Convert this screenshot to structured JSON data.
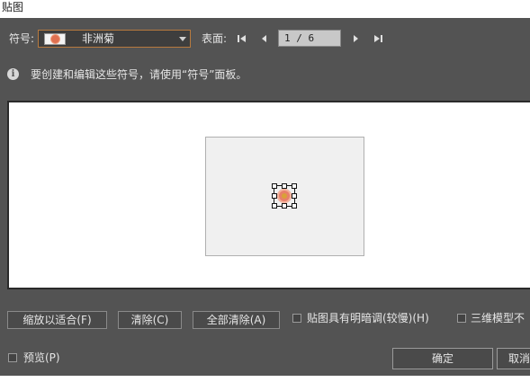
{
  "window": {
    "title": "贴图"
  },
  "symbol": {
    "label": "符号:",
    "selected": "非洲菊",
    "icon": "african-daisy-symbol-icon"
  },
  "surface": {
    "label": "表面:",
    "page_text": "1 / 6"
  },
  "info": {
    "text": "要创建和编辑这些符号，请使用“符号”面板。",
    "icon": "info-icon"
  },
  "buttons": {
    "scale_to_fit": "缩放以适合(F)",
    "clear": "清除(C)",
    "clear_all": "全部清除(A)",
    "ok": "确定",
    "cancel": "取消"
  },
  "options": {
    "shade_artwork": "贴图具有明暗调(较慢)(H)",
    "invisible_geometry": "三维模型不",
    "preview": "预览(P)"
  },
  "colors": {
    "dialog_bg": "#535353",
    "accent_border": "#b87a3e"
  }
}
